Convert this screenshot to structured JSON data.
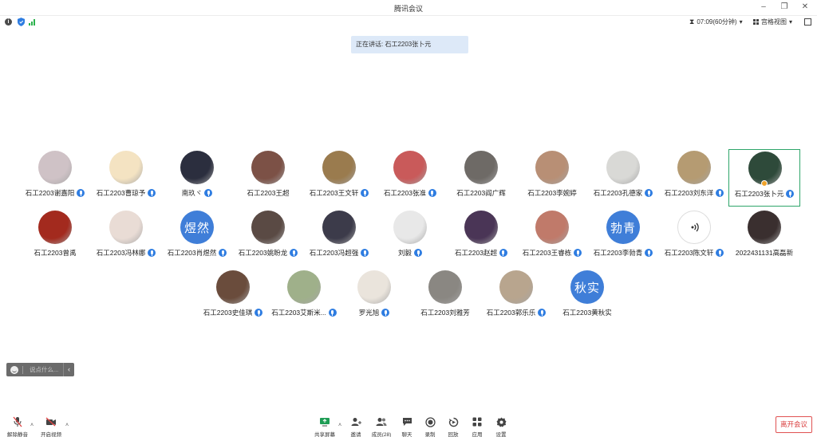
{
  "window": {
    "title": "腾讯会议",
    "controls": [
      "minimize-icon",
      "restore-icon",
      "close-icon"
    ]
  },
  "topbar": {
    "timer": "07:09(60分钟)",
    "view_label": "宫格视图"
  },
  "speaking_banner": "正在讲话: 石工2203张卜元",
  "participants": [
    {
      "name": "石工2203谢嘉阳",
      "mic": true,
      "avatar_kind": "photo",
      "color": "#cfc2c6"
    },
    {
      "name": "石工2203曹琼予",
      "mic": true,
      "avatar_kind": "photo",
      "color": "#f4e3c2"
    },
    {
      "name": "南玖ヾ",
      "mic": true,
      "avatar_kind": "photo",
      "color": "#2b2e3e"
    },
    {
      "name": "石工2203王超",
      "mic": false,
      "avatar_kind": "photo",
      "color": "#7c5146"
    },
    {
      "name": "石工2203王文轩",
      "mic": true,
      "avatar_kind": "photo",
      "color": "#9a7b4e"
    },
    {
      "name": "石工2203张准",
      "mic": true,
      "avatar_kind": "photo",
      "color": "#c95a5a"
    },
    {
      "name": "石工2203阎广辉",
      "mic": false,
      "avatar_kind": "photo",
      "color": "#6e6a66"
    },
    {
      "name": "石工2203李婉婷",
      "mic": false,
      "avatar_kind": "photo",
      "color": "#b88f75"
    },
    {
      "name": "石工2203孔德家",
      "mic": true,
      "avatar_kind": "photo",
      "color": "#d9d9d6"
    },
    {
      "name": "石工2203刘东洋",
      "mic": true,
      "avatar_kind": "photo",
      "color": "#b59b72"
    },
    {
      "name": "石工2203张卜元",
      "mic": true,
      "avatar_kind": "photo",
      "color": "#2e4a3a",
      "speaking": true
    },
    {
      "name": "石工2203曾禹",
      "mic": false,
      "avatar_kind": "photo",
      "color": "#a32a1e"
    },
    {
      "name": "石工2203冯林娜",
      "mic": true,
      "avatar_kind": "photo",
      "color": "#e9dcd5"
    },
    {
      "name": "石工2203肖煜然",
      "mic": true,
      "avatar_kind": "text",
      "avatar_text": "煜然",
      "color": "#3f7ed8"
    },
    {
      "name": "石工2203姚盼龙",
      "mic": true,
      "avatar_kind": "photo",
      "color": "#5a4a44"
    },
    {
      "name": "石工2203冯超强",
      "mic": true,
      "avatar_kind": "photo",
      "color": "#3c3b4a"
    },
    {
      "name": "刘毅",
      "mic": true,
      "avatar_kind": "photo",
      "color": "#e8e8e8"
    },
    {
      "name": "石工2203赵超",
      "mic": true,
      "avatar_kind": "photo",
      "color": "#4a3556"
    },
    {
      "name": "石工2203王睿栋",
      "mic": true,
      "avatar_kind": "photo",
      "color": "#c07a6a"
    },
    {
      "name": "石工2203李勃青",
      "mic": true,
      "avatar_kind": "text",
      "avatar_text": "勃青",
      "color": "#3f7ed8"
    },
    {
      "name": "石工2203陈文轩",
      "mic": true,
      "avatar_kind": "ring",
      "color": "#ffffff"
    },
    {
      "name": "2022431131高磊新",
      "mic": false,
      "avatar_kind": "photo",
      "color": "#3a2f2f"
    },
    {
      "name": "石工2203史佳琪",
      "mic": true,
      "avatar_kind": "photo",
      "color": "#6a4c3c"
    },
    {
      "name": "石工2203艾斯米...",
      "mic": true,
      "avatar_kind": "photo",
      "color": "#9fb08a"
    },
    {
      "name": "罗光旭",
      "mic": true,
      "avatar_kind": "photo",
      "color": "#eae4dc"
    },
    {
      "name": "石工2203刘雅芳",
      "mic": false,
      "avatar_kind": "photo",
      "color": "#8a8782"
    },
    {
      "name": "石工2203郭乐乐",
      "mic": true,
      "avatar_kind": "photo",
      "color": "#b8a58e"
    },
    {
      "name": "石工2203黄秋实",
      "mic": false,
      "avatar_kind": "text",
      "avatar_text": "秋实",
      "color": "#3f7ed8"
    }
  ],
  "chat": {
    "placeholder": "说点什么..."
  },
  "toolbar": {
    "unmute": "解除静音",
    "start_video": "开启视频",
    "share_screen": "共享屏幕",
    "invite": "邀请",
    "members": "成员(28)",
    "chat": "聊天",
    "record": "录制",
    "replay": "回放",
    "apps": "应用",
    "settings": "设置",
    "leave": "离开会议"
  },
  "colors": {
    "accent": "#2f7de1",
    "speaking_border": "#2ea56a",
    "leave": "#d93b3b",
    "banner": "#dde9f8"
  }
}
